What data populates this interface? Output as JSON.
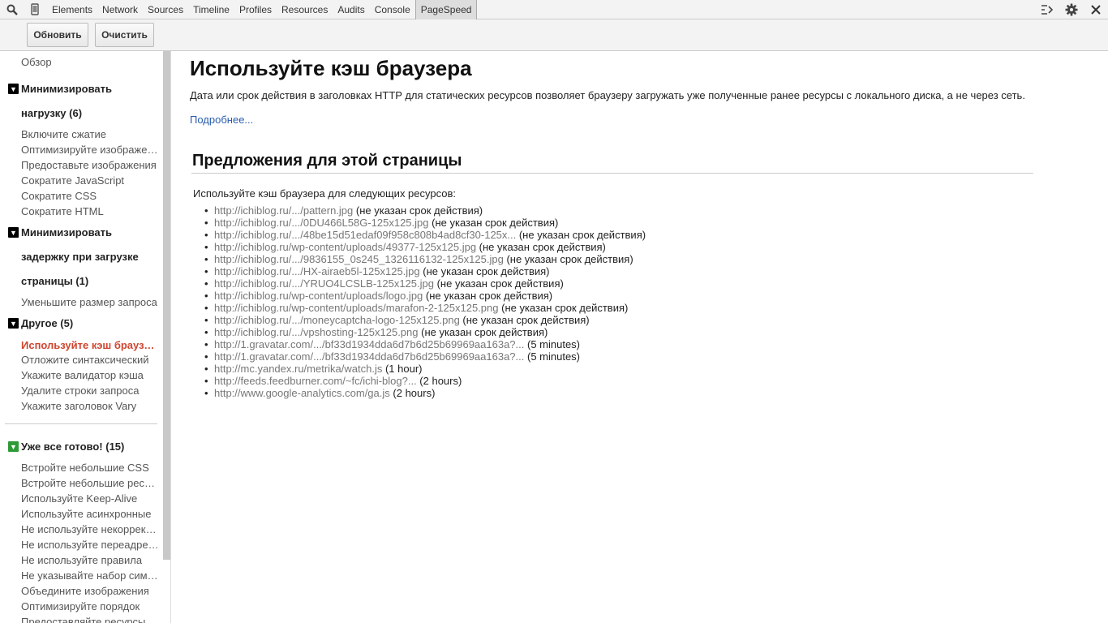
{
  "toolbar": {
    "tabs": [
      "Elements",
      "Network",
      "Sources",
      "Timeline",
      "Profiles",
      "Resources",
      "Audits",
      "Console",
      "PageSpeed"
    ],
    "selected_tab": "PageSpeed"
  },
  "actions": {
    "refresh_label": "Обновить",
    "clear_label": "Очистить"
  },
  "sidebar": {
    "overview": "Обзор",
    "group1": {
      "title_line1": "Минимизировать",
      "title_line2": "нагрузку (6)",
      "items": [
        "Включите сжатие",
        "Оптимизируйте изображения",
        "Предоставьте изображения",
        "Сократите JavaScript",
        "Сократите CSS",
        "Сократите HTML"
      ]
    },
    "group2": {
      "title_line1": "Минимизировать",
      "title_line2": "задержку при загрузке",
      "title_line3": "страницы (1)",
      "items": [
        "Уменьшите размер запроса"
      ]
    },
    "group3": {
      "title": "Другое (5)",
      "items": [
        "Используйте кэш браузера",
        "Отложите синтаксический",
        "Укажите валидатор кэша",
        "Удалите строки запроса",
        "Укажите заголовок Vary"
      ]
    },
    "group4": {
      "title": "Уже все готово! (15)",
      "items": [
        "Встройте небольшие CSS",
        "Встройте небольшие ресурсы",
        "Используйте Keep-Alive",
        "Используйте асинхронные",
        "Не используйте некорректные",
        "Не используйте переадресацию",
        "Не используйте правила",
        "Не указывайте набор символов",
        "Объедините изображения",
        "Оптимизируйте порядок",
        "Предоставляйте ресурсы"
      ]
    }
  },
  "main": {
    "title": "Используйте кэш браузера",
    "description": "Дата или срок действия в заголовках HTTP для статических ресурсов позволяет браузеру загружать уже полученные ранее ресурсы с локального диска, а не через сеть.",
    "more_link": "Подробнее...",
    "suggestions_title": "Предложения для этой страницы",
    "lead": "Используйте кэш браузера для следующих ресурсов:",
    "resources": [
      {
        "url": "http://ichiblog.ru/.../pattern.jpg",
        "note": " (не указан срок действия)"
      },
      {
        "url": "http://ichiblog.ru/.../0DU466L58G-125x125.jpg",
        "note": " (не указан срок действия)"
      },
      {
        "url": "http://ichiblog.ru/.../48be15d51edaf09f958c808b4ad8cf30-125x...",
        "note": " (не указан срок действия)"
      },
      {
        "url": "http://ichiblog.ru/wp-content/uploads/49377-125x125.jpg",
        "note": " (не указан срок действия)"
      },
      {
        "url": "http://ichiblog.ru/.../9836155_0s245_1326116132-125x125.jpg",
        "note": " (не указан срок действия)"
      },
      {
        "url": "http://ichiblog.ru/.../HX-airaeb5l-125x125.jpg",
        "note": " (не указан срок действия)"
      },
      {
        "url": "http://ichiblog.ru/.../YRUO4LCSLB-125x125.jpg",
        "note": " (не указан срок действия)"
      },
      {
        "url": "http://ichiblog.ru/wp-content/uploads/logo.jpg",
        "note": " (не указан срок действия)"
      },
      {
        "url": "http://ichiblog.ru/wp-content/uploads/marafon-2-125x125.png",
        "note": " (не указан срок действия)"
      },
      {
        "url": "http://ichiblog.ru/.../moneycaptcha-logo-125x125.png",
        "note": " (не указан срок действия)"
      },
      {
        "url": "http://ichiblog.ru/.../vpshosting-125x125.png",
        "note": " (не указан срок действия)"
      },
      {
        "url": "http://1.gravatar.com/.../bf33d1934dda6d7b6d25b69969aa163a?...",
        "note": " (5 minutes)"
      },
      {
        "url": "http://1.gravatar.com/.../bf33d1934dda6d7b6d25b69969aa163a?...",
        "note": " (5 minutes)"
      },
      {
        "url": "http://mc.yandex.ru/metrika/watch.js",
        "note": " (1 hour)"
      },
      {
        "url": "http://feeds.feedburner.com/~fc/ichi-blog?...",
        "note": " (2 hours)"
      },
      {
        "url": "http://www.google-analytics.com/ga.js",
        "note": " (2 hours)"
      }
    ]
  }
}
